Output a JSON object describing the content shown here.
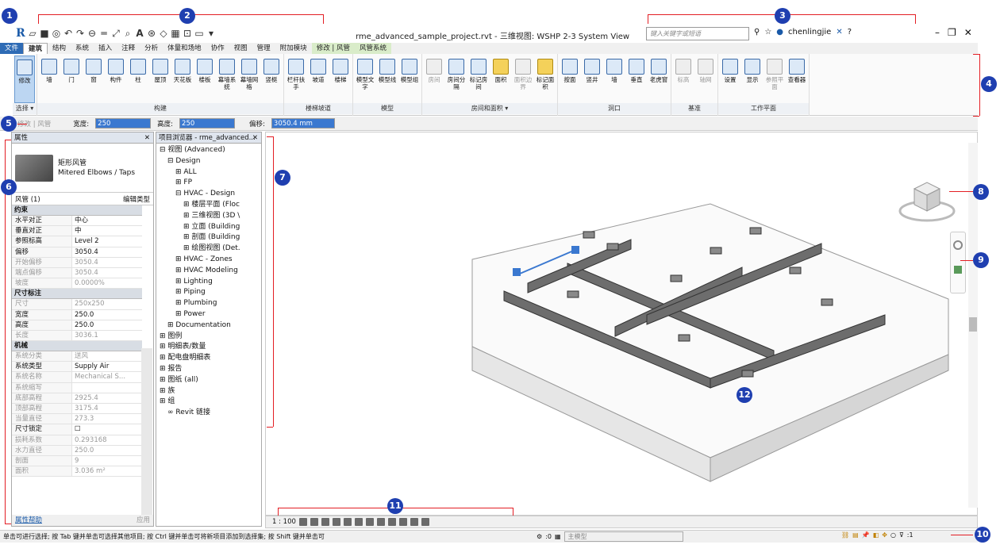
{
  "app": {
    "window_title": "rme_advanced_sample_project.rvt - 三维视图: WSHP 2-3 System View",
    "search_placeholder": "键入关键字或短语",
    "user": "chenlingjie",
    "logo": "R",
    "help": "?"
  },
  "tabs": [
    "文件",
    "建筑",
    "结构",
    "系统",
    "插入",
    "注释",
    "分析",
    "体量和场地",
    "协作",
    "视图",
    "管理",
    "附加模块",
    "修改 | 风管",
    "风管系统"
  ],
  "ribbon": {
    "panels": [
      {
        "title": "选择 ▾",
        "tools": [
          "修改"
        ]
      },
      {
        "title": "构建",
        "tools": [
          "墙",
          "门",
          "窗",
          "构件",
          "柱",
          "屋顶",
          "天花板",
          "楼板",
          "幕墙系统",
          "幕墙网格",
          "竖梃"
        ]
      },
      {
        "title": "楼梯坡道",
        "tools": [
          "栏杆扶手",
          "坡道",
          "楼梯"
        ]
      },
      {
        "title": "模型",
        "tools": [
          "模型文字",
          "模型线",
          "模型组"
        ]
      },
      {
        "title": "房间和面积 ▾",
        "tools": [
          "房间",
          "房间分隔",
          "标记房间",
          "面积",
          "面积边界",
          "标记面积"
        ]
      },
      {
        "title": "洞口",
        "tools": [
          "按面",
          "竖井",
          "墙",
          "垂直",
          "老虎窗"
        ]
      },
      {
        "title": "基准",
        "tools": [
          "标高",
          "轴网"
        ]
      },
      {
        "title": "工作平面",
        "tools": [
          "设置",
          "显示",
          "参照平面",
          "查看器"
        ]
      }
    ]
  },
  "optionsbar": {
    "mode": "修改 | 风管",
    "width_label": "宽度:",
    "width_value": "250",
    "height_label": "高度:",
    "height_value": "250",
    "offset_label": "偏移:",
    "offset_value": "3050.4 mm"
  },
  "properties": {
    "title": "属性",
    "type_name_1": "矩形风管",
    "type_name_2": "Mitered Elbows / Taps",
    "filter": "风管 (1)",
    "edit_type": "编辑类型",
    "footer_link": "属性帮助",
    "apply": "应用",
    "sections": [
      {
        "name": "约束",
        "rows": [
          [
            "水平对正",
            "中心",
            false
          ],
          [
            "垂直对正",
            "中",
            false
          ],
          [
            "参照标高",
            "Level 2",
            false
          ],
          [
            "偏移",
            "3050.4",
            false
          ],
          [
            "开始偏移",
            "3050.4",
            true
          ],
          [
            "端点偏移",
            "3050.4",
            true
          ],
          [
            "坡度",
            "0.0000%",
            true
          ]
        ]
      },
      {
        "name": "尺寸标注",
        "rows": [
          [
            "尺寸",
            "250x250",
            true
          ],
          [
            "宽度",
            "250.0",
            false
          ],
          [
            "高度",
            "250.0",
            false
          ],
          [
            "长度",
            "3036.1",
            true
          ]
        ]
      },
      {
        "name": "机械",
        "rows": [
          [
            "系统分类",
            "送风",
            true
          ],
          [
            "系统类型",
            "Supply Air",
            false
          ],
          [
            "系统名称",
            "Mechanical S...",
            true
          ],
          [
            "系统缩写",
            "",
            true
          ],
          [
            "底部高程",
            "2925.4",
            true
          ],
          [
            "顶部高程",
            "3175.4",
            true
          ],
          [
            "当量直径",
            "273.3",
            true
          ],
          [
            "尺寸锁定",
            "☐",
            false
          ],
          [
            "损耗系数",
            "0.293168",
            true
          ],
          [
            "水力直径",
            "250.0",
            true
          ],
          [
            "剖面",
            "9",
            true
          ],
          [
            "面积",
            "3.036 m²",
            true
          ]
        ]
      }
    ]
  },
  "browser": {
    "title": "项目浏览器 - rme_advanced...",
    "items": [
      {
        "t": "⊟ 视图 (Advanced)",
        "l": 0
      },
      {
        "t": "⊟ Design",
        "l": 1
      },
      {
        "t": "⊞ ALL",
        "l": 2
      },
      {
        "t": "⊞ FP",
        "l": 2
      },
      {
        "t": "⊟ HVAC - Design",
        "l": 2
      },
      {
        "t": "⊞ 楼层平面 (Floc",
        "l": 3
      },
      {
        "t": "⊞ 三维视图 (3D \\",
        "l": 3
      },
      {
        "t": "⊞ 立面 (Building",
        "l": 3
      },
      {
        "t": "⊞ 剖面 (Building",
        "l": 3
      },
      {
        "t": "⊞ 绘图视图 (Det.",
        "l": 3
      },
      {
        "t": "⊞ HVAC - Zones",
        "l": 2
      },
      {
        "t": "⊞ HVAC Modeling",
        "l": 2
      },
      {
        "t": "⊞ Lighting",
        "l": 2
      },
      {
        "t": "⊞ Piping",
        "l": 2
      },
      {
        "t": "⊞ Plumbing",
        "l": 2
      },
      {
        "t": "⊞ Power",
        "l": 2
      },
      {
        "t": "⊞ Documentation",
        "l": 1
      },
      {
        "t": "⊞ 图例",
        "l": 0
      },
      {
        "t": "⊞ 明细表/数量",
        "l": 0
      },
      {
        "t": "⊞ 配电盘明细表",
        "l": 0
      },
      {
        "t": "⊞ 报告",
        "l": 0
      },
      {
        "t": "⊞ 图纸 (all)",
        "l": 0
      },
      {
        "t": "⊞ 族",
        "l": 0
      },
      {
        "t": "⊞ 组",
        "l": 0
      },
      {
        "t": "∞ Revit 链接",
        "l": 1
      }
    ]
  },
  "viewbar": {
    "scale": "1 : 100"
  },
  "status": {
    "message": "单击可进行选择; 按 Tab 键并单击可选择其他项目; 按 Ctrl 键并单击可将新项目添加到选择集; 按 Shift 键并单击可",
    "workset_value": ":0",
    "model": "主模型",
    "filter_count": ":1"
  },
  "callouts": [
    "1",
    "2",
    "3",
    "4",
    "5",
    "6",
    "7",
    "8",
    "9",
    "10",
    "11",
    "12"
  ],
  "colors": {
    "callout": "#1f3fb0",
    "leader": "#e31e24",
    "ctx_tab": "#d9ecc9"
  }
}
